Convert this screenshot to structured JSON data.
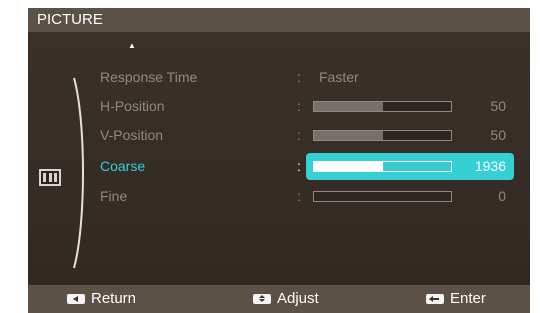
{
  "title": "PICTURE",
  "menu": {
    "scroll_up_icon": "arrow-up-icon",
    "category_icon": "picture-menu-icon",
    "items": [
      {
        "label": "Response Time",
        "value": "Faster",
        "type": "text",
        "selected": false
      },
      {
        "label": "H-Position",
        "value": "50",
        "level": 0.5,
        "type": "slider",
        "selected": false
      },
      {
        "label": "V-Position",
        "value": "50",
        "level": 0.5,
        "type": "slider",
        "selected": false
      },
      {
        "label": "Coarse",
        "value": "1936",
        "level": 0.5,
        "type": "slider",
        "selected": true
      },
      {
        "label": "Fine",
        "value": "0",
        "level": 0,
        "type": "slider",
        "selected": false
      }
    ],
    "separator": ":"
  },
  "footer": {
    "return_label": "Return",
    "adjust_label": "Adjust",
    "enter_label": "Enter",
    "return_icon": "return-key-icon",
    "adjust_icon": "up-down-key-icon",
    "enter_icon": "enter-key-icon"
  },
  "colors": {
    "background": "#3d342c",
    "bars": "#5c5146",
    "accent": "#34d0d6",
    "muted_text": "#8f8983",
    "white": "#ffffff"
  }
}
